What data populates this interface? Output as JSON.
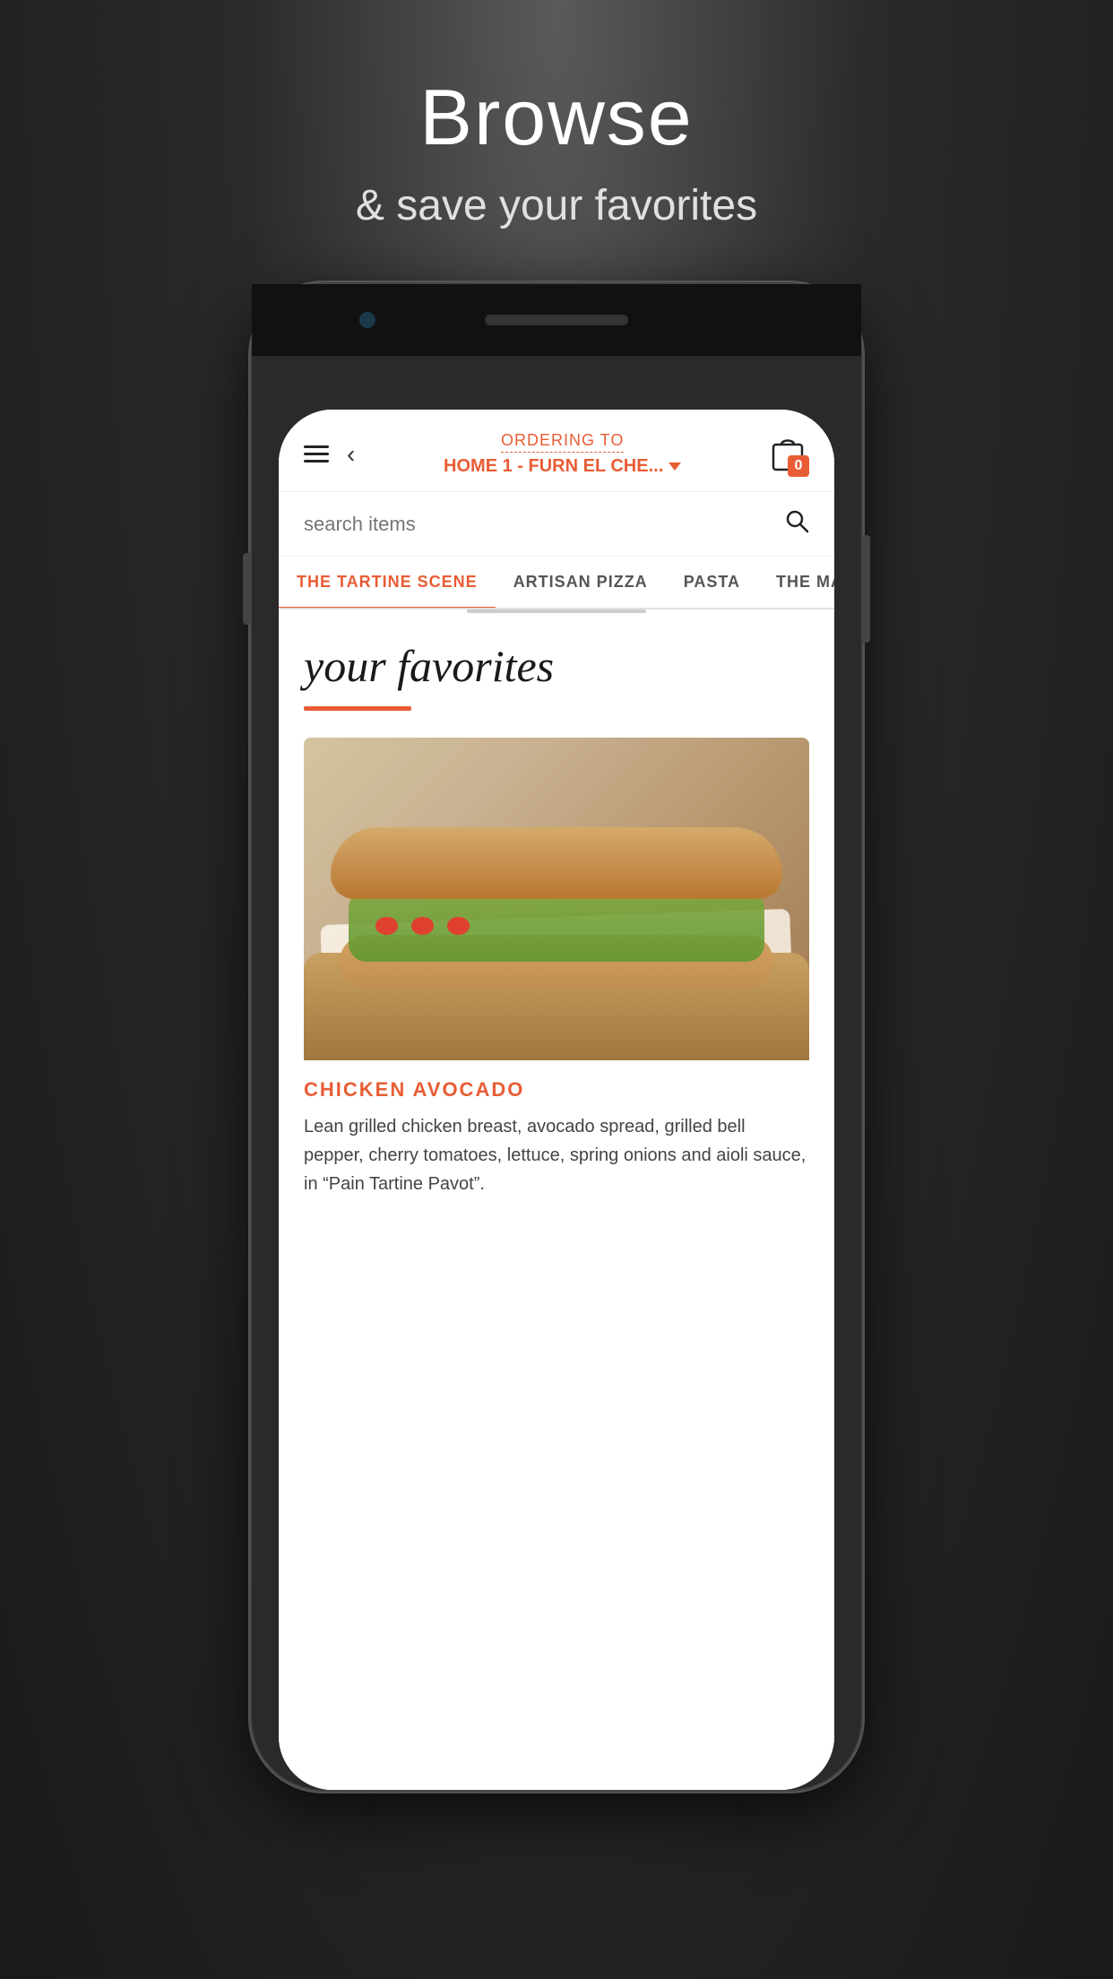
{
  "page": {
    "title": "Browse",
    "subtitle": "& save your favorites"
  },
  "header": {
    "ordering_to_label": "ORDERING TO",
    "address": "HOME 1 - FURN EL CHE...",
    "dropdown_aria": "change address"
  },
  "cart": {
    "count": "0"
  },
  "search": {
    "placeholder": "search items"
  },
  "tabs": [
    {
      "label": "THE TARTINE SCENE",
      "active": true
    },
    {
      "label": "ARTISAN PIZZA",
      "active": false
    },
    {
      "label": "PASTA",
      "active": false
    },
    {
      "label": "THE MA...",
      "active": false
    }
  ],
  "favorites": {
    "section_title": "your favorites",
    "item": {
      "name": "CHICKEN AVOCADO",
      "description": "Lean grilled chicken breast, avocado spread, grilled bell pepper, cherry tomatoes, lettuce, spring onions and aioli sauce, in “Pain Tartine Pavot”."
    }
  },
  "icons": {
    "hamburger": "☰",
    "back": "‹",
    "search": "🔍",
    "bag": "🛍"
  }
}
